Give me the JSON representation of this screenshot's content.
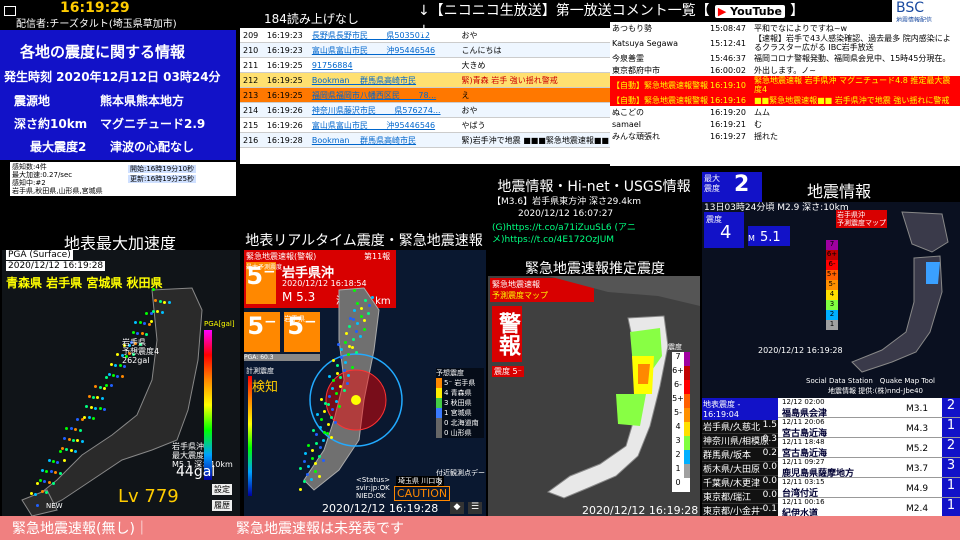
{
  "clock": "16:19:29",
  "broadcaster": "配信者:チーズタルト(埼玉県草加市)",
  "info": {
    "title": "各地の震度に関する情報",
    "time": "発生時刻 2020年12月12日 03時24分",
    "epicenter_label": "震源地",
    "epicenter": "熊本県熊本地方",
    "depth": "深さ約10km",
    "magnitude": "マグニチュード2.9",
    "max_int": "最大震度2",
    "tsunami": "津波の心配なし"
  },
  "sensor": {
    "l1": "感知数:4件",
    "l2": "最大加速:0.27/sec",
    "l3": "感知中:#2",
    "l4": "岩手県,秋田県,山形県,宮城県",
    "start": "開始:16時19分10秒",
    "update": "更新:16時19分25秒"
  },
  "comments": {
    "header": "184読み上げなし",
    "rows": [
      {
        "no": "209",
        "time": "16:19:23",
        "user": "長野県長野市民 　　県5035012",
        "text": "おや",
        "style": "white"
      },
      {
        "no": "210",
        "time": "16:19:23",
        "user": "富山県富山市民 　　沖95446546",
        "text": "こんにちは",
        "style": "white"
      },
      {
        "no": "211",
        "time": "16:19:25",
        "user": "91756884",
        "text": "大きめ",
        "style": "white"
      },
      {
        "no": "212",
        "time": "16:19:25",
        "user": "Bookman 　群馬県高崎市民",
        "text": "緊)青森 岩手 強い揺れ警戒",
        "style": "yellow"
      },
      {
        "no": "213",
        "time": "16:19:25",
        "user": "福岡県福岡市八幡西区民 　　78...",
        "text": "え",
        "style": "orange"
      },
      {
        "no": "214",
        "time": "16:19:26",
        "user": "神奈川県藤沢市民 　　県576274...",
        "text": "おや",
        "style": "white"
      },
      {
        "no": "215",
        "time": "16:19:26",
        "user": "富山県富山市民 　　沖95446546",
        "text": "やばう",
        "style": "white"
      },
      {
        "no": "216",
        "time": "16:19:28",
        "user": "Bookman 　群馬県高崎市民",
        "text": "緊)岩手沖で地震 ■■■緊急地震速報■■",
        "style": "white"
      }
    ]
  },
  "header_bar": "↓【ニコニコ生放送】第一放送コメント一覧【",
  "youtube": {
    "label": "YouTube",
    "arrow": "】↓",
    "rows": [
      {
        "user": "あつもり勢",
        "time": "15:08:47",
        "text": "平和でなによりですね~w",
        "style": "white"
      },
      {
        "user": "Katsuya Segawa",
        "time": "15:12:41",
        "text": "【速報】岩手で43人感染確認、過去最多 院内感染によるクラスター広がる IBC岩手放送",
        "style": "white"
      },
      {
        "user": "今泉善霊",
        "time": "15:46:37",
        "text": "福岡コロナ警報発動、福岡県会見中、15時45分現在。",
        "style": "white"
      },
      {
        "user": "東京都府中市",
        "time": "16:00:02",
        "text": "外出します。ノ~",
        "style": "white"
      },
      {
        "user": "【自動】緊急地震速報警報",
        "time": "16:19:10",
        "text": "緊急地震速報 岩手県沖 マグニチュード4.8 推定最大震度4",
        "style": "red"
      },
      {
        "user": "【自動】緊急地震速報警報",
        "time": "16:19:16",
        "text": "■■緊急地震速報■■ 岩手県沖で地震 強い揺れに警戒",
        "style": "red"
      },
      {
        "user": "ぬこどの",
        "time": "16:19:20",
        "text": "ムム",
        "style": "white"
      },
      {
        "user": "samael",
        "time": "16:19:21",
        "text": "む",
        "style": "white"
      },
      {
        "user": "みんな頑張れ",
        "time": "16:19:27",
        "text": "揺れた",
        "style": "white"
      }
    ]
  },
  "bsc": "BSC",
  "bsc_sub": "地震情報配信",
  "pga": {
    "title": "地表最大加速度",
    "label": "PGA (Surface)",
    "datetime": "2020/12/12 16:19:28",
    "prefs": "青森県 岩手県 宮城県 秋田県",
    "annot1": "岩手県\n予想震度4\n262gal",
    "annot2": "岩手県沖\n最大震度4\nM5.1 深さ10km",
    "gal": "44gal",
    "lv": "Lv 779",
    "new_label": "NEW",
    "scale_label": "PGA[gal]",
    "btn1": "設定",
    "btn2": "履歴"
  },
  "rt": {
    "title": "地表リアルタイム震度・緊急地震速報",
    "eew": "緊急地震速報(警報)",
    "num": "第11報",
    "place_label": "最大予測震度",
    "region": "岩手県沖",
    "int": "5⁻",
    "datetime": "2020/12/12 16:18:54",
    "mag": "M 5.3",
    "depth": "深さ 40 km",
    "left_int": "5⁻",
    "right_int": "5⁻",
    "right_label": "岩手県",
    "pga_label": "PGA: 60.3",
    "detect": "検知",
    "calc": "計測震度",
    "legend": [
      "5⁻ 岩手県",
      "4 青森県",
      "3 秋田県",
      "1 宮城県",
      "0 北海道南",
      "0 山形県"
    ],
    "legend_title": "予想震度",
    "status": "<Status>\nsvir:jp:OK\nNIED:OK",
    "station": "埼玉県 川口市",
    "caution": "CAUTION",
    "footer_dt": "2020/12/12 16:19:28",
    "note": "付近観測点データ"
  },
  "hinet": {
    "title": "地震情報・Hi-net・USGS情報",
    "line1": "【M3.6】岩手県東方沖 深さ29.4km",
    "line2": "2020/12/12 16:07:27",
    "line3": "(G)https://t.co/a71iZuuSL6 (アニ",
    "line4": "メ)https://t.co/4E172OzJUM"
  },
  "est": {
    "title": "緊急地震速報推定震度",
    "eew": "緊急地震速報",
    "map_label": "予測震度マップ",
    "warning": "警報",
    "int_label": "震度 5⁻",
    "scale_title": "震度",
    "scale": [
      "7",
      "6+",
      "6-",
      "5+",
      "5-",
      "4",
      "3",
      "2",
      "1",
      "0"
    ],
    "footer": "2020/12/12  16:19:28"
  },
  "quake": {
    "title": "地震情報",
    "max_label": "最大\n震度",
    "max": "2",
    "partial": "13日03時24分頃 M2.9 深さ:10km",
    "int_label": "震度",
    "int": "4",
    "mag": "M",
    "mag_val": "5.1",
    "map_labels": [
      "岩手県沖",
      "予測震度マップ"
    ],
    "datetime": "2020/12/12 16:19:28",
    "credit": "Social Data Station　Quake Map Tool",
    "credit2": "地震情報 提供:(株)nnd-Jbe40",
    "scale": [
      "7",
      "6+",
      "6-",
      "5+",
      "5-",
      "4",
      "3",
      "2",
      "1"
    ]
  },
  "local": {
    "header": "地表震度 - 16:19:04",
    "rows": [
      {
        "name": "岩手県/久慈北",
        "val": "1.5"
      },
      {
        "name": "神奈川県/相模原",
        "val": "0.3"
      },
      {
        "name": "群馬県/坂本",
        "val": "0.2"
      },
      {
        "name": "栃木県/大田原",
        "val": "0.0"
      },
      {
        "name": "千葉県/木更津",
        "val": "0.0"
      },
      {
        "name": "東京都/瑞江",
        "val": "0.0"
      },
      {
        "name": "東京都/小金井",
        "val": "-0.1"
      },
      {
        "name": "埼玉県/川口",
        "val": "-0.2"
      }
    ]
  },
  "quake_list": [
    {
      "date": "12/12 02:00",
      "place": "福島県会津",
      "mag": "M3.1",
      "int": "2"
    },
    {
      "date": "12/11 20:06",
      "place": "宮古島近海",
      "mag": "M4.3",
      "int": "1"
    },
    {
      "date": "12/11 18:48",
      "place": "宮古島近海",
      "mag": "M5.2",
      "int": "2"
    },
    {
      "date": "12/11 09:27",
      "place": "鹿児島県薩摩地方",
      "mag": "M3.7",
      "int": "3"
    },
    {
      "date": "12/11 03:15",
      "place": "台湾付近",
      "mag": "M4.9",
      "int": "1"
    },
    {
      "date": "12/11 00:16",
      "place": "紀伊水道",
      "mag": "M2.4",
      "int": "1"
    }
  ],
  "ticker": {
    "left": "緊急地震速報(無し)｜",
    "right": "緊急地震速報は未発表です"
  },
  "colors": {
    "red": "#ff0000",
    "orange": "#ff7800",
    "yellow": "#ffe070",
    "blue": "#1212c8",
    "pink": "#f08080",
    "int5minus": "#ff8800"
  }
}
